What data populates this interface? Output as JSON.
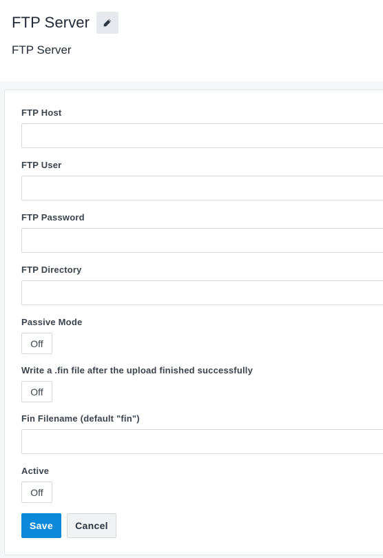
{
  "header": {
    "title": "FTP Server",
    "subtitle": "FTP Server",
    "edit_icon": "pencil-icon"
  },
  "form": {
    "fields": {
      "host": {
        "label": "FTP Host",
        "value": ""
      },
      "user": {
        "label": "FTP User",
        "value": ""
      },
      "password": {
        "label": "FTP Password",
        "value": ""
      },
      "directory": {
        "label": "FTP Directory",
        "value": ""
      },
      "passive": {
        "label": "Passive Mode",
        "state": "Off"
      },
      "write_fin": {
        "label": "Write a .fin file after the upload finished successfully",
        "state": "Off"
      },
      "fin_filename": {
        "label": "Fin Filename (default \"fin\")",
        "value": ""
      },
      "active": {
        "label": "Active",
        "state": "Off"
      }
    },
    "save_label": "Save",
    "cancel_label": "Cancel"
  },
  "colors": {
    "primary": "#0a8ad8",
    "background": "#f5f6f8",
    "card": "#ffffff"
  }
}
